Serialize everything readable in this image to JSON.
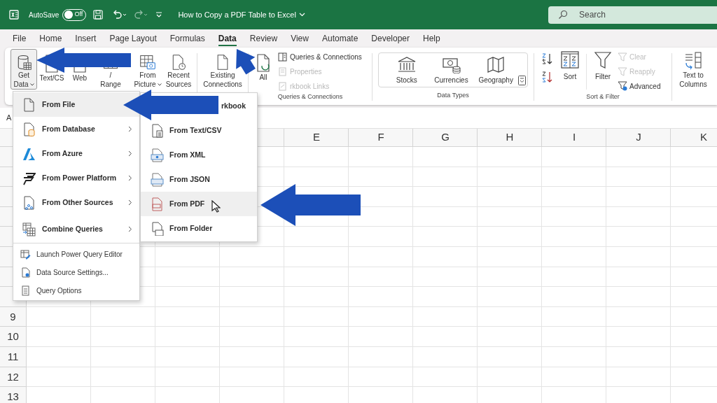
{
  "title_bar": {
    "autosave_label": "AutoSave",
    "autosave": {
      "on": false,
      "label": "Off"
    },
    "document_title": "How to Copy a PDF Table to Excel",
    "search": {
      "placeholder": "Search"
    }
  },
  "tabs": [
    {
      "label": "File",
      "selected": false
    },
    {
      "label": "Home",
      "selected": false
    },
    {
      "label": "Insert",
      "selected": false
    },
    {
      "label": "Page Layout",
      "selected": false
    },
    {
      "label": "Formulas",
      "selected": false
    },
    {
      "label": "Data",
      "selected": true
    },
    {
      "label": "Review",
      "selected": false
    },
    {
      "label": "View",
      "selected": false
    },
    {
      "label": "Automate",
      "selected": false
    },
    {
      "label": "Developer",
      "selected": false
    },
    {
      "label": "Help",
      "selected": false
    }
  ],
  "ribbon": {
    "get_transform": [
      {
        "lines": [
          "Get",
          "Data"
        ],
        "dropdown": true,
        "open": true
      },
      {
        "lines": [
          "Text/CS"
        ],
        "dropdown": false,
        "open": false
      },
      {
        "lines": [
          "Web"
        ],
        "dropdown": false,
        "open": false
      },
      {
        "lines": [
          "/",
          "Range"
        ],
        "dropdown": false,
        "open": false
      },
      {
        "lines": [
          "From",
          "Picture"
        ],
        "dropdown": true,
        "open": false
      },
      {
        "lines": [
          "Recent",
          "Sources"
        ],
        "dropdown": false,
        "open": false
      },
      {
        "lines": [
          "Existing",
          "Connections"
        ],
        "dropdown": false,
        "open": false
      }
    ],
    "queries": {
      "large": {
        "lines": [
          "All"
        ]
      },
      "small": [
        {
          "label": "Queries & Connections",
          "disabled": false
        },
        {
          "label": "Properties",
          "disabled": true
        },
        {
          "label": "rkbook Links",
          "disabled": true
        }
      ],
      "group_label": "Queries & Connections"
    },
    "data_types": {
      "items": [
        "Stocks",
        "Currencies",
        "Geography"
      ],
      "group_label": "Data Types"
    },
    "sort_filter": {
      "sort_label": "Sort",
      "filter_label": "Filter",
      "small": [
        {
          "label": "Clear",
          "disabled": true
        },
        {
          "label": "Reapply",
          "disabled": true
        },
        {
          "label": "Advanced",
          "disabled": false
        }
      ],
      "group_label": "Sort & Filter"
    },
    "data_tools": {
      "lines": [
        "Text to",
        "Columns"
      ]
    }
  },
  "name_box": "A",
  "sheet": {
    "column_headers": [
      "E",
      "F",
      "G",
      "H",
      "I",
      "J",
      "K"
    ],
    "row_numbers": [
      "9",
      "10",
      "11",
      "12",
      "13"
    ]
  },
  "get_data_menu": {
    "items": [
      {
        "label": "From File",
        "submenu": false,
        "selected": true
      },
      {
        "label": "From Database",
        "submenu": true,
        "selected": false
      },
      {
        "label": "From Azure",
        "submenu": true,
        "selected": false
      },
      {
        "label": "From Power Platform",
        "submenu": true,
        "selected": false
      },
      {
        "label": "From Other Sources",
        "submenu": true,
        "selected": false
      },
      {
        "label": "Combine Queries",
        "submenu": true,
        "selected": false
      }
    ],
    "commands": [
      "Launch Power Query Editor",
      "Data Source Settings...",
      "Query Options"
    ]
  },
  "from_file_menu": [
    {
      "label": "rkbook",
      "selected": false
    },
    {
      "label": "From Text/CSV",
      "selected": false
    },
    {
      "label": "From XML",
      "selected": false
    },
    {
      "label": "From JSON",
      "selected": false
    },
    {
      "label": "From PDF",
      "selected": true
    },
    {
      "label": "From Folder",
      "selected": false
    }
  ]
}
